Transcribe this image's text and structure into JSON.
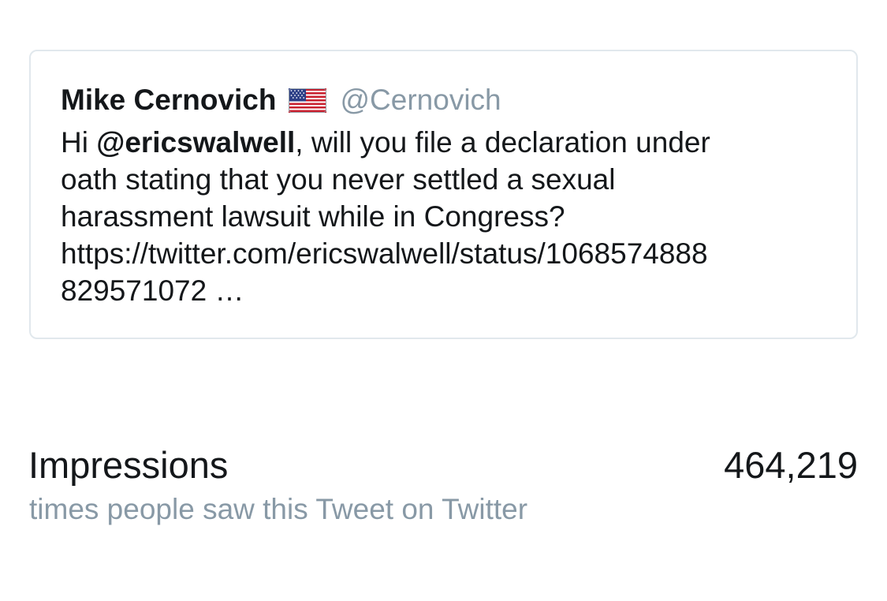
{
  "tweet": {
    "author_name": "Mike Cernovich",
    "flag_icon": "us-flag-emoji",
    "handle": "@Cernovich",
    "text": {
      "prefix": "Hi ",
      "mention": "@ericswalwell",
      "line1_rest": ", will you file a declaration under",
      "line2": "oath stating that you never settled a sexual",
      "line3": "harassment lawsuit while in Congress?",
      "line4": "https://twitter.com/ericswalwell/status/1068574888",
      "line5": "829571072 …"
    }
  },
  "metric": {
    "label": "Impressions",
    "value": "464,219",
    "description": "times people saw this Tweet on Twitter"
  },
  "colors": {
    "text_primary": "#14171a",
    "text_secondary": "#8899a6",
    "card_border": "#e1e8ed"
  }
}
